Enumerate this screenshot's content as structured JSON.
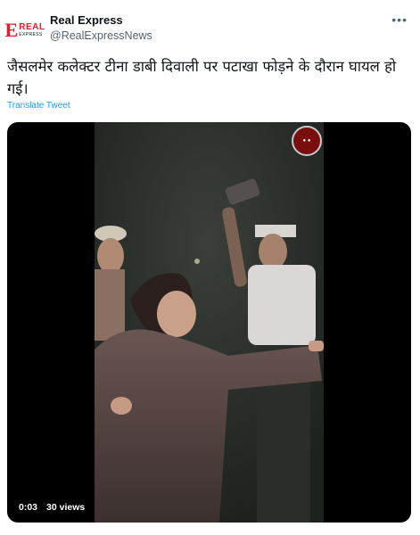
{
  "author": {
    "name": "Real Express",
    "handle": "@RealExpressNews",
    "avatar_logo": {
      "letter": "E",
      "top": "REAL",
      "bottom": "EXPRESS"
    }
  },
  "tweet": {
    "text": "जैसलमेर कलेक्टर टीना डाबी दिवाली पर पटाखा फोड़ने के दौरान घायल हो गई।",
    "translate_label": "Translate Tweet"
  },
  "video": {
    "elapsed": "0:03",
    "views": "30 views",
    "watermark_icon": "channel-logo-icon"
  },
  "colors": {
    "accent": "#1d9bf0",
    "brand_red": "#d9232e",
    "secondary_text": "#536471"
  }
}
